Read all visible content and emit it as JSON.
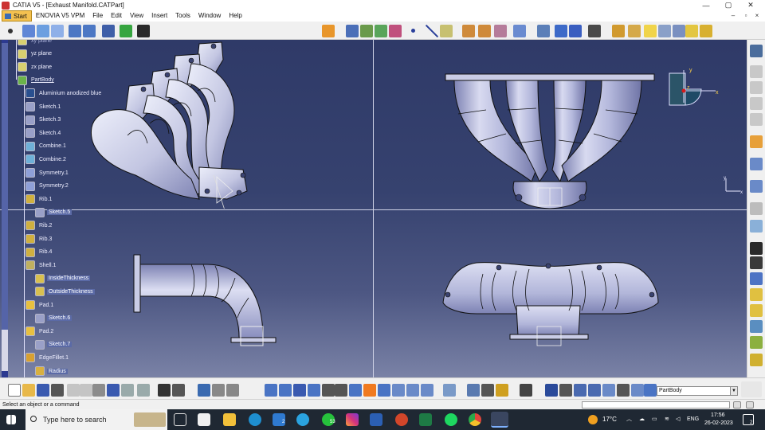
{
  "window": {
    "title": "CATIA V5 - [Exhaust Manifold.CATPart]",
    "controls": [
      "—",
      "▢",
      "✕"
    ]
  },
  "menu": {
    "items": [
      "Start",
      "ENOVIA V5 VPM",
      "File",
      "Edit",
      "View",
      "Insert",
      "Tools",
      "Window",
      "Help"
    ],
    "mdi_controls": [
      "–",
      "▫",
      "×"
    ]
  },
  "tree": {
    "items": [
      {
        "label": "xy plane",
        "icon": "plane-icon",
        "style": "dim"
      },
      {
        "label": "yz plane",
        "icon": "plane-icon",
        "style": ""
      },
      {
        "label": "zx plane",
        "icon": "plane-icon",
        "style": ""
      },
      {
        "label": "PartBody",
        "icon": "partbody-icon",
        "style": "ul"
      },
      {
        "label": "Aluminium anodized blue",
        "icon": "material-icon",
        "style": ""
      },
      {
        "label": "Sketch.1",
        "icon": "sketch-icon",
        "style": ""
      },
      {
        "label": "Sketch.3",
        "icon": "sketch-icon",
        "style": ""
      },
      {
        "label": "Sketch.4",
        "icon": "sketch-icon",
        "style": ""
      },
      {
        "label": "Combine.1",
        "icon": "combine-icon",
        "style": ""
      },
      {
        "label": "Combine.2",
        "icon": "combine-icon",
        "style": ""
      },
      {
        "label": "Symmetry.1",
        "icon": "symmetry-icon",
        "style": ""
      },
      {
        "label": "Symmetry.2",
        "icon": "symmetry-icon",
        "style": ""
      },
      {
        "label": "Rib.1",
        "icon": "rib-icon",
        "style": ""
      },
      {
        "label": "Sketch.5",
        "icon": "sketch-icon",
        "style": "hl"
      },
      {
        "label": "Rib.2",
        "icon": "rib-icon",
        "style": ""
      },
      {
        "label": "Rib.3",
        "icon": "rib-icon",
        "style": ""
      },
      {
        "label": "Rib.4",
        "icon": "rib-icon",
        "style": ""
      },
      {
        "label": "Shell.1",
        "icon": "shell-icon",
        "style": ""
      },
      {
        "label": "InsideThickness",
        "icon": "thickness-icon",
        "style": "hl"
      },
      {
        "label": "OutsideThickness",
        "icon": "thickness-icon",
        "style": "hl"
      },
      {
        "label": "Pad.1",
        "icon": "pad-icon",
        "style": ""
      },
      {
        "label": "Sketch.6",
        "icon": "sketch-icon",
        "style": "hl"
      },
      {
        "label": "Pad.2",
        "icon": "pad-icon",
        "style": ""
      },
      {
        "label": "Sketch.7",
        "icon": "sketch-icon",
        "style": "hl"
      },
      {
        "label": "EdgeFillet.1",
        "icon": "fillet-icon",
        "style": ""
      },
      {
        "label": "Radius",
        "icon": "radius-icon",
        "style": "hl"
      }
    ]
  },
  "compass": {
    "x": "x",
    "y": "y",
    "z": "z"
  },
  "axis_small": {
    "x": "x",
    "y": "y"
  },
  "bottom_toolbar": {
    "body_select": "PartBody"
  },
  "status": {
    "message": "Select an object or a command"
  },
  "taskbar": {
    "search_placeholder": "Type here to search",
    "weather": "17°C",
    "language": "ENG",
    "time": "17:56",
    "date": "26-02-2023",
    "badges": {
      "mail": "2",
      "whatsapp": "53",
      "notifications": "2"
    }
  },
  "colors": {
    "viewport_top": "#2f3a68",
    "viewport_bottom": "#7a82a6",
    "part_fill": "#c9cce6",
    "part_shade": "#7f84b4",
    "tree_highlight": "#5b6aa6"
  }
}
